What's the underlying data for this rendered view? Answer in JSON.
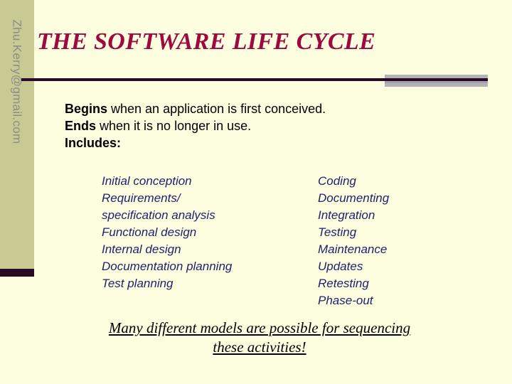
{
  "slide": {
    "title": "THE SOFTWARE LIFE CYCLE",
    "sidebar_credit": "Zhu.Kerry@gmail.com",
    "colors": {
      "background": "#fdfddf",
      "sidebar": "#c9c993",
      "title": "#9c0a40",
      "rule": "#260a26",
      "accent_bar": "#b3b3b3",
      "list_text": "#1f1f6e",
      "credit_text": "#8d8d86"
    },
    "body": {
      "line1_lead": "Begins",
      "line1_rest": " when an application is first conceived.",
      "line2_lead": "Ends",
      "line2_rest": " when it is no longer in use.",
      "line3_lead": "Includes:"
    },
    "activities_left": [
      "Initial conception",
      "Requirements/",
      "specification analysis",
      "Functional design",
      "Internal design",
      "Documentation planning",
      "Test planning"
    ],
    "activities_right": [
      "Coding",
      "Documenting",
      "Integration",
      "Testing",
      "Maintenance",
      "Updates",
      "Retesting",
      "Phase-out"
    ],
    "closing_line1": "Many different models are possible for sequencing",
    "closing_line2": "these activities!"
  }
}
